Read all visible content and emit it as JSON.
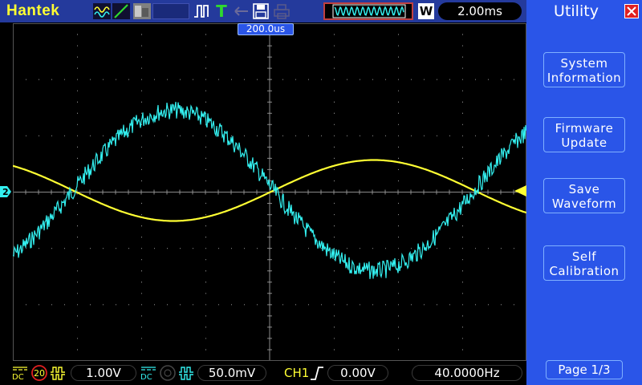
{
  "header": {
    "brand": "Hantek",
    "timebase": "2.00ms",
    "window_badge": "W",
    "center_time": "200.0us"
  },
  "panel": {
    "title": "Utility",
    "buttons": [
      {
        "line1": "System",
        "line2": "Information"
      },
      {
        "line1": "Firmware",
        "line2": "Update"
      },
      {
        "line1": "Save",
        "line2": "Waveform"
      },
      {
        "line1": "Self",
        "line2": "Calibration"
      }
    ],
    "page": "Page 1/3"
  },
  "footer": {
    "ch1_coupling": "DC",
    "ch1_bw": "20",
    "ch1_scale": "1.00V",
    "ch2_coupling": "DC",
    "ch2_scale": "50.0mV",
    "trigger_source": "CH1",
    "trigger_level": "0.00V",
    "frequency": "40.0000Hz"
  },
  "markers": {
    "ch2": "2"
  },
  "colors": {
    "ch1": "#ffff33",
    "ch2": "#33f0f0",
    "panel": "#2a55e8",
    "topbar": "#243a9c",
    "grid": "#8a8a8a"
  }
}
